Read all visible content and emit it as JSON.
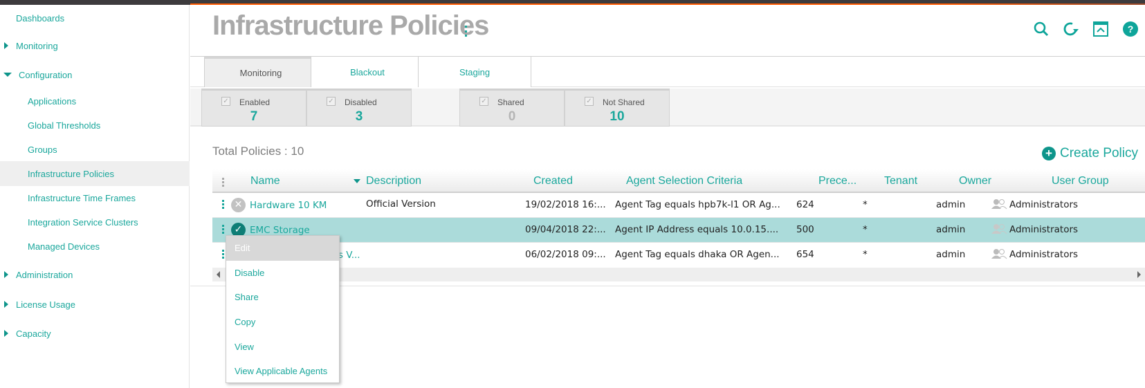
{
  "colors": {
    "accent": "#1aa79c",
    "accent_dark": "#0e958b",
    "selected_row": "#abdbda",
    "topbar_accent": "#ff5a00"
  },
  "sidebar": {
    "items": [
      {
        "label": "Dashboards",
        "level": "top",
        "expander": "none"
      },
      {
        "label": "Monitoring",
        "level": "top",
        "expander": "collapsed"
      },
      {
        "label": "Configuration",
        "level": "top",
        "expander": "expanded"
      },
      {
        "label": "Applications",
        "level": "sub"
      },
      {
        "label": "Global Thresholds",
        "level": "sub"
      },
      {
        "label": "Groups",
        "level": "sub"
      },
      {
        "label": "Infrastructure Policies",
        "level": "sub",
        "active": true
      },
      {
        "label": "Infrastructure Time Frames",
        "level": "sub"
      },
      {
        "label": "Integration Service Clusters",
        "level": "sub"
      },
      {
        "label": "Managed Devices",
        "level": "sub"
      },
      {
        "label": "Administration",
        "level": "top",
        "expander": "collapsed"
      },
      {
        "label": "License Usage",
        "level": "top",
        "expander": "collapsed"
      },
      {
        "label": "Capacity",
        "level": "top",
        "expander": "collapsed"
      }
    ]
  },
  "header": {
    "title": "Infrastructure Policies",
    "icons": [
      "search-icon",
      "refresh-icon",
      "collapse-panel-icon",
      "help-icon"
    ]
  },
  "tabs": [
    {
      "label": "Monitoring",
      "active": true
    },
    {
      "label": "Blackout"
    },
    {
      "label": "Staging"
    }
  ],
  "filters": [
    {
      "label": "Enabled",
      "count": "7"
    },
    {
      "label": "Disabled",
      "count": "3"
    },
    {
      "label": "Shared",
      "count": "0"
    },
    {
      "label": "Not Shared",
      "count": "10"
    }
  ],
  "summary": {
    "total_label": "Total Policies : 10"
  },
  "create_label": "Create Policy",
  "table": {
    "columns": [
      "Name",
      "Description",
      "Created",
      "Agent Selection Criteria",
      "Prece...",
      "Tenant",
      "Owner",
      "User Group"
    ],
    "rows": [
      {
        "status": "disabled",
        "name": "Hardware 10 KM",
        "description": "Official Version",
        "created": "19/02/2018 16:...",
        "criteria": "Agent Tag equals hpb7k-l1 OR Ag...",
        "precedence": "624",
        "tenant": "*",
        "owner": "admin",
        "user_group": "Administrators"
      },
      {
        "status": "enabled",
        "name": "EMC Storage",
        "description": "",
        "created": "09/04/2018 22:...",
        "criteria": "Agent IP Address equals 10.0.15....",
        "precedence": "500",
        "tenant": "*",
        "owner": "admin",
        "user_group": "Administrators",
        "selected": true
      },
      {
        "status": "enabled",
        "name": "...als V...",
        "description": "",
        "created": "06/02/2018 09:...",
        "criteria": "Agent Tag equals dhaka OR Agen...",
        "precedence": "654",
        "tenant": "*",
        "owner": "admin",
        "user_group": "Administrators"
      }
    ]
  },
  "context_menu": {
    "items": [
      {
        "label": "Edit",
        "hover": true
      },
      {
        "label": "Disable"
      },
      {
        "label": "Share"
      },
      {
        "label": "Copy"
      },
      {
        "label": "View"
      },
      {
        "label": "View Applicable Agents"
      }
    ]
  }
}
